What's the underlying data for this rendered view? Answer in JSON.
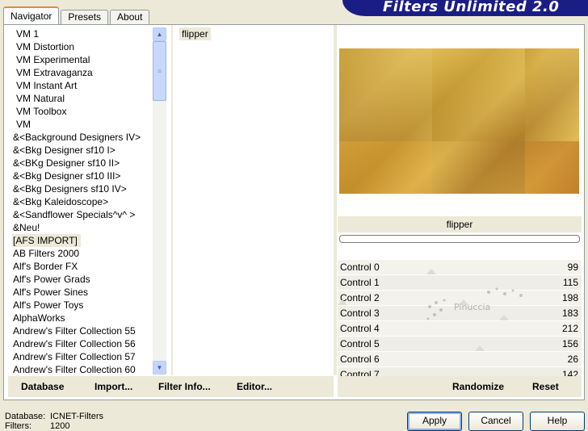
{
  "app": {
    "title": "Filters Unlimited 2.0"
  },
  "tabs": [
    {
      "label": "Navigator"
    },
    {
      "label": "Presets"
    },
    {
      "label": "About"
    }
  ],
  "categories": [
    "VM 1",
    "VM Distortion",
    "VM Experimental",
    "VM Extravaganza",
    "VM Instant Art",
    "VM Natural",
    "VM Toolbox",
    "VM",
    "&<Background Designers IV>",
    "&<Bkg Designer sf10 I>",
    "&<BKg Designer sf10 II>",
    "&<Bkg Designer sf10 III>",
    "&<Bkg Designers sf10 IV>",
    "&<Bkg Kaleidoscope>",
    "&<Sandflower Specials^v^ >",
    "&Neu!",
    "[AFS IMPORT]",
    "AB Filters 2000",
    "Alf's Border FX",
    "Alf's Power Grads",
    "Alf's Power Sines",
    "Alf's Power Toys",
    "AlphaWorks",
    "Andrew's Filter Collection 55",
    "Andrew's Filter Collection 56",
    "Andrew's Filter Collection 57",
    "Andrew's Filter Collection 60"
  ],
  "selected_category_index": 16,
  "filters": [
    "flipper"
  ],
  "preview": {
    "filter_name": "flipper"
  },
  "controls": [
    {
      "label": "Control 0",
      "value": "99"
    },
    {
      "label": "Control 1",
      "value": "115"
    },
    {
      "label": "Control 2",
      "value": "198"
    },
    {
      "label": "Control 3",
      "value": "183"
    },
    {
      "label": "Control 4",
      "value": "212"
    },
    {
      "label": "Control 5",
      "value": "156"
    },
    {
      "label": "Control 6",
      "value": "26"
    },
    {
      "label": "Control 7",
      "value": "142"
    }
  ],
  "left_buttons": {
    "database": "Database",
    "import": "Import...",
    "filter_info": "Filter Info...",
    "editor": "Editor..."
  },
  "right_buttons": {
    "randomize": "Randomize",
    "reset": "Reset"
  },
  "status": {
    "database_label": "Database:",
    "database_value": "ICNET-Filters",
    "filters_label": "Filters:",
    "filters_value": "1200"
  },
  "dialog_buttons": {
    "apply": "Apply",
    "cancel": "Cancel",
    "help": "Help"
  },
  "watermark": {
    "text": "Pinuccia"
  },
  "colors": {
    "brand_bg": "#1a1e84",
    "tab_highlight": "#e68b2c",
    "panel_bg": "#ece9d8"
  }
}
